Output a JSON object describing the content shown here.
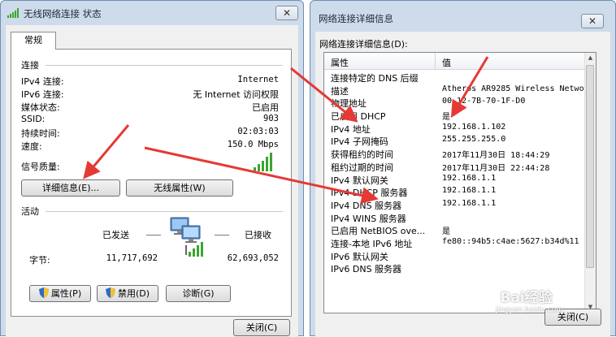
{
  "status_window": {
    "title": "无线网络连接 状态",
    "tab": "常规",
    "connection_section": "连接",
    "rows": [
      {
        "label": "IPv4 连接:",
        "value": "Internet"
      },
      {
        "label": "IPv6 连接:",
        "value": "无 Internet 访问权限"
      },
      {
        "label": "媒体状态:",
        "value": "已启用"
      },
      {
        "label": "SSID:",
        "value": "903"
      },
      {
        "label": "持续时间:",
        "value": "02:03:03"
      },
      {
        "label": "速度:",
        "value": "150.0 Mbps"
      }
    ],
    "signal_label": "信号质量:",
    "details_button": "详细信息(E)...",
    "wireless_props_button": "无线属性(W)",
    "activity_section": "活动",
    "sent_label": "已发送",
    "received_label": "已接收",
    "bytes_label": "字节:",
    "bytes_sent": "11,717,692",
    "bytes_received": "62,693,052",
    "properties_button": "属性(P)",
    "disable_button": "禁用(D)",
    "diagnose_button": "诊断(G)",
    "close_button": "关闭(C)"
  },
  "details_window": {
    "title": "网络连接详细信息",
    "group_label": "网络连接详细信息(D):",
    "col_property": "属性",
    "col_value": "值",
    "rows": [
      {
        "property": "连接特定的 DNS 后缀",
        "value": ""
      },
      {
        "property": "描述",
        "value": "Atheros AR9285 Wireless Networ"
      },
      {
        "property": "物理地址",
        "value": "00-12-7B-70-1F-D0"
      },
      {
        "property": "已启用 DHCP",
        "value": "是"
      },
      {
        "property": "IPv4 地址",
        "value": "192.168.1.102"
      },
      {
        "property": "IPv4 子网掩码",
        "value": "255.255.255.0"
      },
      {
        "property": "获得租约的时间",
        "value": "2017年11月30日 18:44:29"
      },
      {
        "property": "租约过期的时间",
        "value": "2017年11月30日 22:44:28"
      },
      {
        "property": "IPv4 默认网关",
        "value": "192.168.1.1"
      },
      {
        "property": "IPv4 DHCP 服务器",
        "value": "192.168.1.1"
      },
      {
        "property": "IPv4 DNS 服务器",
        "value": "192.168.1.1"
      },
      {
        "property": "IPv4 WINS 服务器",
        "value": ""
      },
      {
        "property": "已启用 NetBIOS ove...",
        "value": "是"
      },
      {
        "property": "连接-本地 IPv6 地址",
        "value": "fe80::94b5:c4ae:5627:b34d%11"
      },
      {
        "property": "IPv6 默认网关",
        "value": ""
      },
      {
        "property": "IPv6 DNS 服务器",
        "value": ""
      }
    ],
    "close_button": "关闭(C)"
  },
  "watermark": {
    "brand": "Bai经验",
    "url": "jingyan.baidu.com"
  },
  "colors": {
    "annotation_arrow": "#e53935",
    "signal_bar": "#3aa62f",
    "title_bar": "#cddbea"
  }
}
